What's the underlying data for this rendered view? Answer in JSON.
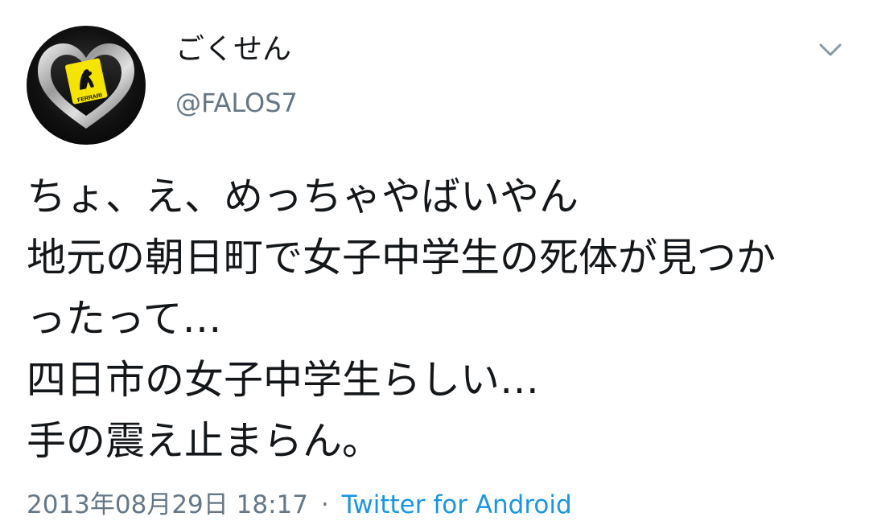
{
  "tweet": {
    "author": {
      "display_name": "ごくせん",
      "handle": "@FALOS7",
      "avatar_badge_text": "FERRARI"
    },
    "caret_icon": "chevron-down-icon",
    "text_lines": [
      "ちょ、え、めっちゃやばいやん",
      "地元の朝日町で女子中学生の死体が見つか",
      "ったって…",
      "四日市の女子中学生らしい…",
      "手の震え止まらん。"
    ],
    "timestamp": "2013年08月29日 18:17",
    "separator": "·",
    "source": "Twitter for Android"
  },
  "colors": {
    "text_primary": "#14171a",
    "text_secondary": "#657786",
    "link": "#1b95e0",
    "caret": "#8899a6"
  }
}
